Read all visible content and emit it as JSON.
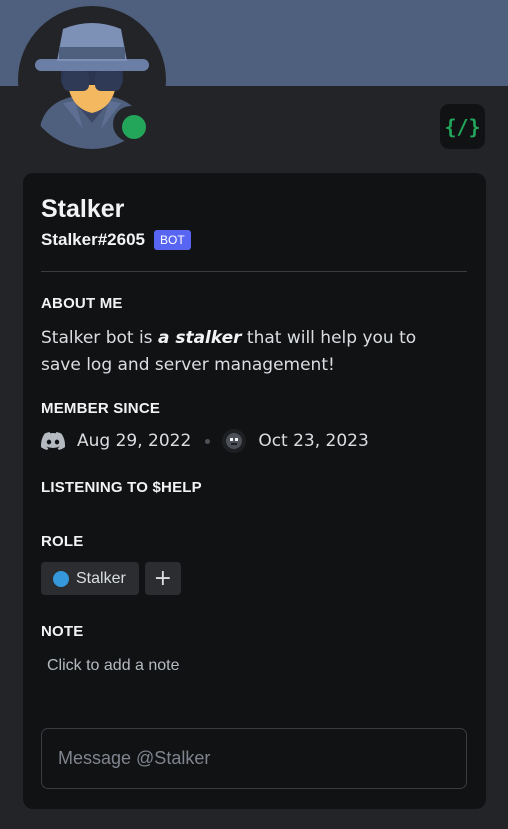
{
  "profile": {
    "display_name": "Stalker",
    "username": "Stalker#2605",
    "bot_tag": "BOT",
    "status": "online",
    "banner_color": "#4f5f7e",
    "status_color": "#23a55a",
    "dev_badge_glyph": "{/}",
    "avatar_icon": "spy-avatar-icon"
  },
  "about": {
    "heading": "ABOUT ME",
    "text_before": "Stalker bot is ",
    "text_emphasis": "a stalker",
    "text_after": " that will help you to save log and server management!"
  },
  "member_since": {
    "heading": "MEMBER SINCE",
    "discord_date": "Aug 29, 2022",
    "server_date": "Oct 23, 2023",
    "discord_icon": "discord-icon",
    "server_icon": "server-icon"
  },
  "activity": {
    "heading": "LISTENING TO $HELP"
  },
  "role": {
    "heading": "ROLE",
    "items": [
      {
        "name": "Stalker",
        "color": "#3498db"
      }
    ],
    "add_label": "+"
  },
  "note": {
    "heading": "NOTE",
    "placeholder": "Click to add a note"
  },
  "message": {
    "placeholder": "Message @Stalker"
  }
}
